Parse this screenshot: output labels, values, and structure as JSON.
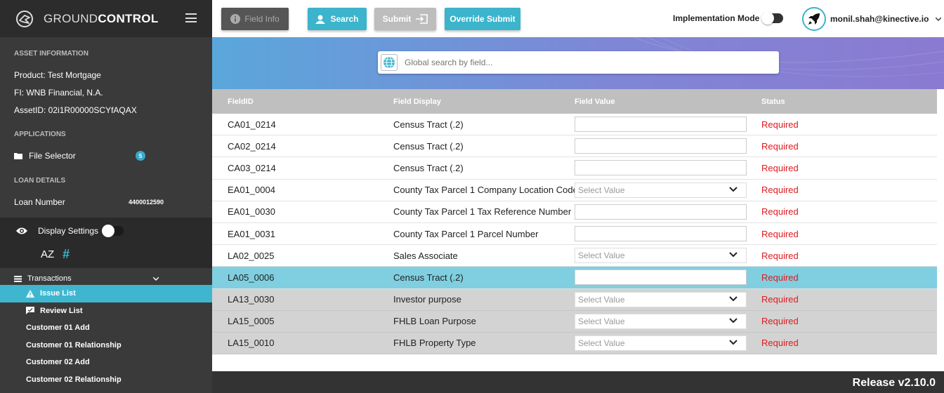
{
  "brand": {
    "light": "GROUND",
    "bold": "CONTROL"
  },
  "sidebar": {
    "asset_info_title": "ASSET INFORMATION",
    "product": "Product:  Test Mortgage",
    "fi": "FI:  WNB Financial, N.A.",
    "asset_id": "AssetID:  02i1R00000SCYfAQAX",
    "applications_title": "APPLICATIONS",
    "file_selector_label": "File Selector",
    "file_selector_badge": "5",
    "loan_details_title": "LOAN DETAILS",
    "loan_number_label": "Loan Number",
    "loan_number_value": "4400012590",
    "display_settings_label": "Display Settings",
    "sort_az_label": "AZ",
    "hash_label": "#",
    "transactions_label": "Transactions",
    "transactions": [
      {
        "label": "Issue List",
        "active": true,
        "icon": "warning-icon"
      },
      {
        "label": "Review List",
        "active": false,
        "icon": "review-icon"
      },
      {
        "label": "Customer 01 Add",
        "active": false
      },
      {
        "label": "Customer 01 Relationship",
        "active": false
      },
      {
        "label": "Customer 02 Add",
        "active": false
      },
      {
        "label": "Customer 02 Relationship",
        "active": false
      }
    ]
  },
  "toolbar": {
    "field_info": "Field Info",
    "search": "Search",
    "submit": "Submit",
    "override_submit": "Override Submit",
    "implementation_mode": "Implementation Mode",
    "user_email": "monil.shah@kinective.io"
  },
  "search": {
    "placeholder": "Global search by field..."
  },
  "table": {
    "headers": {
      "id": "FieldID",
      "display": "Field Display",
      "value": "Field Value",
      "status": "Status"
    },
    "select_placeholder": "Select Value",
    "rows": [
      {
        "id": "CA01_0214",
        "display": "Census Tract (.2)",
        "type": "input",
        "status": "Required",
        "style": "normal"
      },
      {
        "id": "CA02_0214",
        "display": "Census Tract (.2)",
        "type": "input",
        "status": "Required",
        "style": "normal"
      },
      {
        "id": "CA03_0214",
        "display": "Census Tract (.2)",
        "type": "input",
        "status": "Required",
        "style": "normal"
      },
      {
        "id": "EA01_0004",
        "display": "County Tax Parcel 1 Company Location Code",
        "type": "select",
        "status": "Required",
        "style": "normal"
      },
      {
        "id": "EA01_0030",
        "display": "County Tax Parcel 1 Tax Reference Number",
        "type": "input",
        "status": "Required",
        "style": "normal"
      },
      {
        "id": "EA01_0031",
        "display": "County Tax Parcel 1 Parcel Number",
        "type": "input",
        "status": "Required",
        "style": "normal"
      },
      {
        "id": "LA02_0025",
        "display": "Sales Associate",
        "type": "select",
        "status": "Required",
        "style": "normal"
      },
      {
        "id": "LA05_0006",
        "display": "Census Tract (.2)",
        "type": "input",
        "status": "Required",
        "style": "selected"
      },
      {
        "id": "LA13_0030",
        "display": "Investor purpose",
        "type": "select",
        "status": "Required",
        "style": "grey"
      },
      {
        "id": "LA15_0005",
        "display": "FHLB Loan Purpose",
        "type": "select",
        "status": "Required",
        "style": "grey"
      },
      {
        "id": "LA15_0010",
        "display": "FHLB Property Type",
        "type": "select",
        "status": "Required",
        "style": "grey"
      }
    ]
  },
  "footer": {
    "release": "Release v2.10.0"
  },
  "colors": {
    "accent": "#3bb4cc",
    "required": "#e0191f",
    "sidebar": "#3a3a3a",
    "selected_row": "#7fcfe0"
  }
}
